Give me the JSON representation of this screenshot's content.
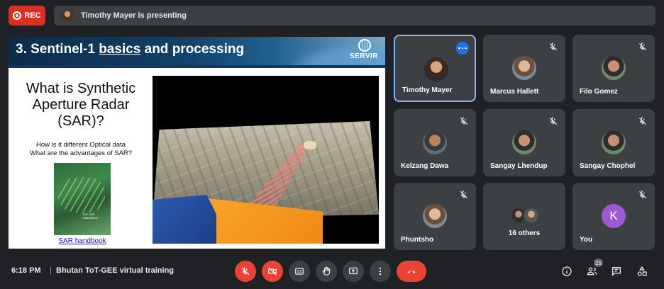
{
  "recording": {
    "label": "REC"
  },
  "banner": {
    "presenter_text": "Timothy Mayer is presenting"
  },
  "slide": {
    "title_prefix": "3. Sentinel-1 ",
    "title_underlined": "basics",
    "title_suffix": " and processing",
    "logo_text": "SERVIR",
    "heading": "What is Synthetic Aperture Radar (SAR)?",
    "subtitle_line1": "How is it different Optical data",
    "subtitle_line2": "What are the advantages of SAR?",
    "book_cover_text": "THE SAR HANDBOOK",
    "link_text": "SAR handbook"
  },
  "participants": [
    {
      "name": "Timothy Mayer",
      "muted": false,
      "active": true
    },
    {
      "name": "Marcus Hallett",
      "muted": true
    },
    {
      "name": "Filo Gomez",
      "muted": true
    },
    {
      "name": "Kelzang Dawa",
      "muted": true
    },
    {
      "name": "Sangay Lhendup",
      "muted": true
    },
    {
      "name": "Sangay Chophel",
      "muted": true
    },
    {
      "name": "Phuntsho",
      "muted": true
    },
    {
      "name": "16 others",
      "muted": false
    },
    {
      "name": "You",
      "initial": "K",
      "muted": true
    }
  ],
  "footer": {
    "time": "6:18 PM",
    "separator": "|",
    "meeting_name": "Bhutan ToT-GEE virtual training",
    "participant_count": "25"
  },
  "colors": {
    "background": "#202124",
    "tile": "#3c4043",
    "danger": "#ea4335",
    "active_border": "#8ab4f8",
    "you_avatar": "#9c59d1"
  }
}
